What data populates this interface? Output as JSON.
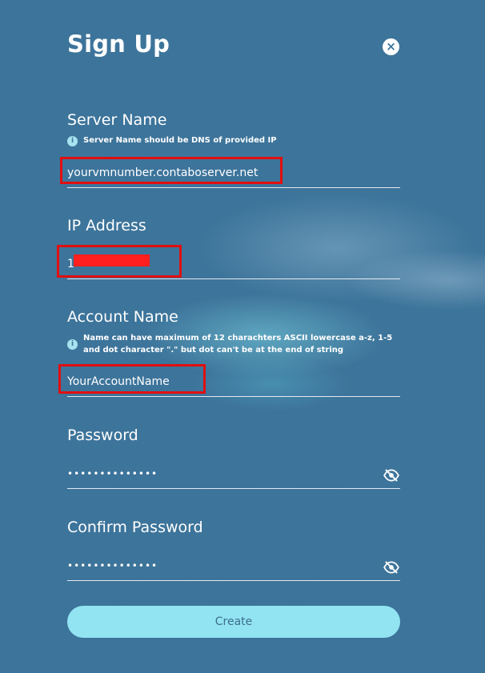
{
  "form": {
    "title": "Sign Up",
    "close_icon": "×",
    "info_icon": "i",
    "server_name": {
      "label": "Server Name",
      "hint": "Server Name should be DNS of provided IP",
      "value": "yourvmnumber.contaboserver.net"
    },
    "ip_address": {
      "label": "IP Address",
      "value": "1"
    },
    "account_name": {
      "label": "Account Name",
      "hint": "Name can have maximum of 12 charachters ASCII lowercase a-z, 1-5 and dot character \".\" but dot can't be at the end of string",
      "value": "YourAccountName"
    },
    "password": {
      "label": "Password",
      "value": "••••••••••••••"
    },
    "confirm_password": {
      "label": "Confirm Password",
      "value": "••••••••••••••"
    },
    "create_label": "Create"
  },
  "icons": {
    "close": "close-icon",
    "info": "info-icon",
    "visibility": "eye-slash-icon"
  },
  "colors": {
    "background": "#3c749b",
    "button": "#92e4f2",
    "highlight": "#e10f0f"
  }
}
